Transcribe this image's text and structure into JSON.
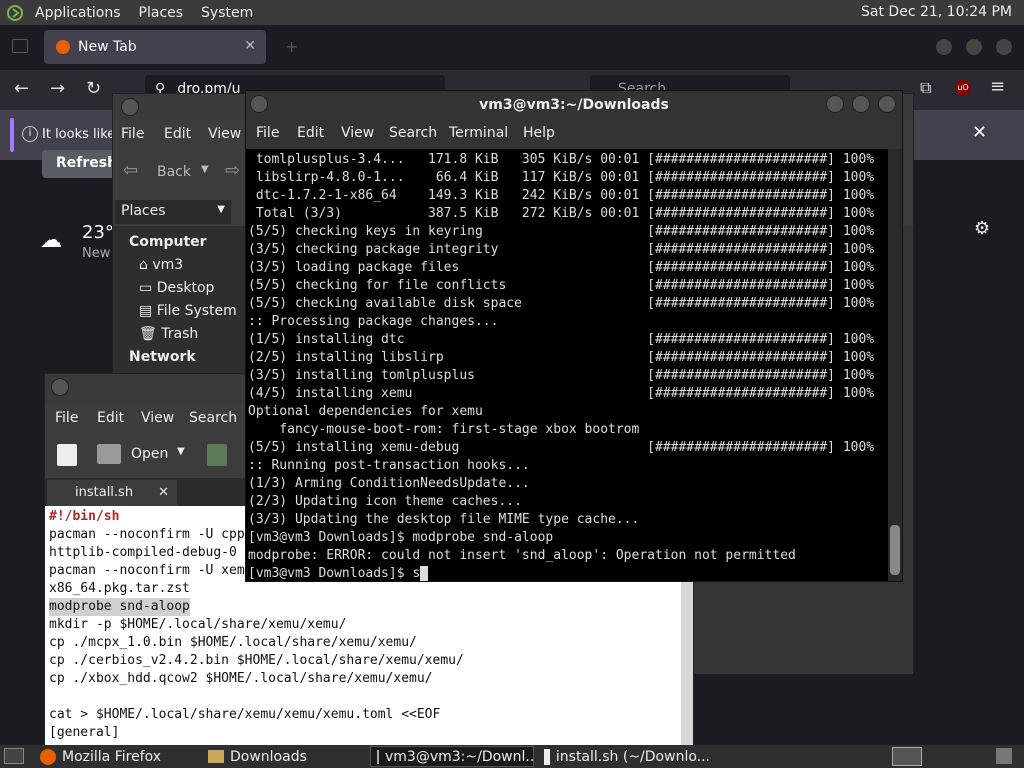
{
  "top_panel": {
    "menus": [
      "Applications",
      "Places",
      "System"
    ],
    "clock": "Sat Dec 21, 10:24 PM"
  },
  "firefox": {
    "tab_title": "New Tab",
    "url_text": "dro.pm/u",
    "search_text": "Search",
    "notification_text": "It looks like",
    "refresh_label": "Refresh F",
    "weather_temp": "23°",
    "weather_sub": "New"
  },
  "nautilus": {
    "menu": [
      "File",
      "Edit",
      "View"
    ],
    "back_label": "Back",
    "places_label": "Places",
    "sidebar": {
      "computer_header": "Computer",
      "items": [
        "vm3",
        "Desktop",
        "File System",
        "Trash"
      ],
      "network_header": "Network"
    }
  },
  "gedit": {
    "menu": [
      "File",
      "Edit",
      "View",
      "Search"
    ],
    "open_label": "Open",
    "tab_label": "install.sh",
    "lines": [
      "#!/bin/sh",
      "pacman --noconfirm -U cpp",
      "httplib-compiled-debug-0",
      "pacman --noconfirm -U xem",
      "x86_64.pkg.tar.zst",
      "modprobe snd-aloop",
      "mkdir -p $HOME/.local/share/xemu/xemu/",
      "cp ./mcpx_1.0.bin $HOME/.local/share/xemu/xemu/",
      "cp ./cerbios_v2.4.2.bin $HOME/.local/share/xemu/xemu/",
      "cp ./xbox_hdd.qcow2 $HOME/.local/share/xemu/xemu/",
      "",
      "cat > $HOME/.local/share/xemu/xemu/xemu.toml <<EOF",
      "[general]"
    ]
  },
  "terminal": {
    "title": "vm3@vm3:~/Downloads",
    "menu": [
      "File",
      "Edit",
      "View",
      "Search",
      "Terminal",
      "Help"
    ],
    "lines": [
      " tomlplusplus-3.4...   171.8 KiB   305 KiB/s 00:01 [######################] 100%",
      " libslirp-4.8.0-1...    66.4 KiB   117 KiB/s 00:01 [######################] 100%",
      " dtc-1.7.2-1-x86_64    149.3 KiB   242 KiB/s 00:01 [######################] 100%",
      " Total (3/3)           387.5 KiB   272 KiB/s 00:01 [######################] 100%",
      "(5/5) checking keys in keyring                     [######################] 100%",
      "(3/5) checking package integrity                   [######################] 100%",
      "(3/5) loading package files                        [######################] 100%",
      "(5/5) checking for file conflicts                  [######################] 100%",
      "(5/5) checking available disk space                [######################] 100%",
      ":: Processing package changes...",
      "(1/5) installing dtc                               [######################] 100%",
      "(2/5) installing libslirp                          [######################] 100%",
      "(3/5) installing tomlplusplus                      [######################] 100%",
      "(4/5) installing xemu                              [######################] 100%",
      "Optional dependencies for xemu",
      "    fancy-mouse-boot-rom: first-stage xbox bootrom",
      "(5/5) installing xemu-debug                        [######################] 100%",
      ":: Running post-transaction hooks...",
      "(1/3) Arming ConditionNeedsUpdate...",
      "(2/3) Updating icon theme caches...",
      "(3/3) Updating the desktop file MIME type cache...",
      "[vm3@vm3 Downloads]$ modprobe snd-aloop",
      "modprobe: ERROR: could not insert 'snd_aloop': Operation not permitted",
      "[vm3@vm3 Downloads]$ s"
    ]
  },
  "taskbar": {
    "tasks": [
      "Mozilla Firefox",
      "Downloads",
      "vm3@vm3:~/Downl...",
      "install.sh (~/Downlo..."
    ]
  },
  "colors": {
    "terminal_bg": "#000000",
    "panel_bg": "#3b3b3b",
    "firefox_accent": "#a67aff"
  }
}
